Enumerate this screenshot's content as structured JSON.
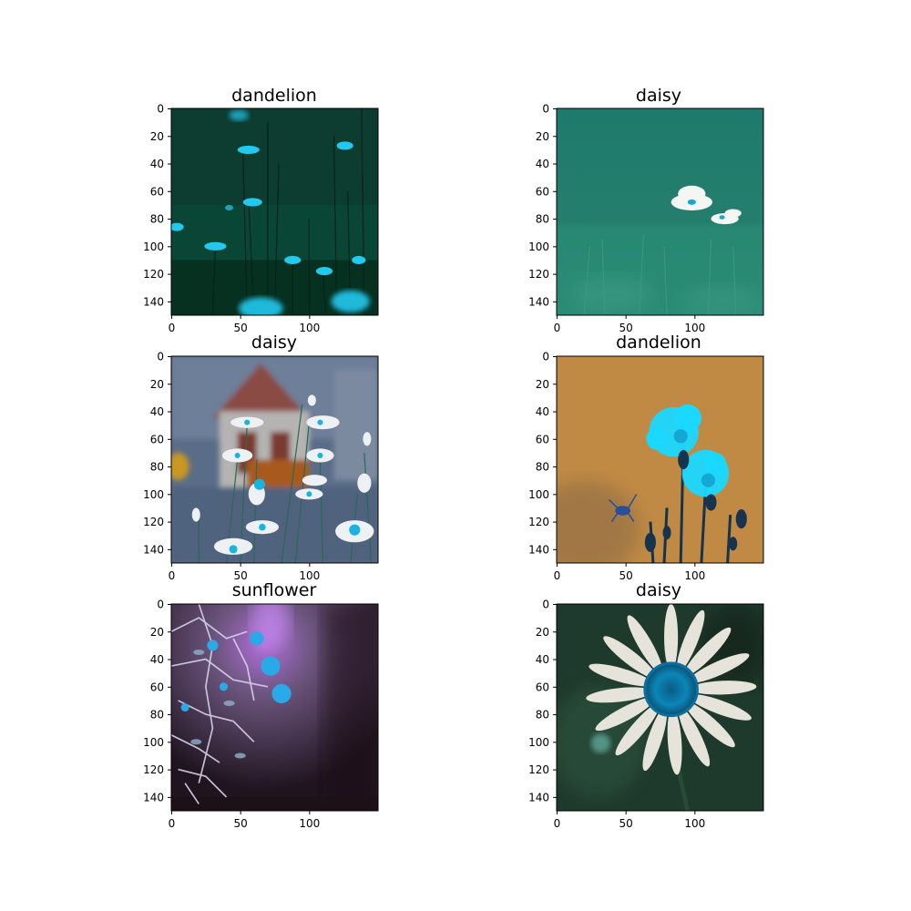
{
  "figure": {
    "layout": "3x2 grid of image subplots",
    "background": "#ffffff"
  },
  "chart_data": [
    {
      "type": "image",
      "title": "dandelion",
      "xlabel": "",
      "ylabel": "",
      "xlim": [
        0,
        150
      ],
      "ylim": [
        150,
        0
      ],
      "xticks": [
        0,
        50,
        100
      ],
      "yticks": [
        0,
        20,
        40,
        60,
        80,
        100,
        120,
        140
      ],
      "dominant_colors": [
        "#063828",
        "#0b4a3a",
        "#1ec6e8"
      ],
      "content": "dark green grass with small cyan flowers on thin stems"
    },
    {
      "type": "image",
      "title": "daisy",
      "xlabel": "",
      "ylabel": "",
      "xlim": [
        0,
        150
      ],
      "ylim": [
        150,
        0
      ],
      "xticks": [
        0,
        50,
        100
      ],
      "yticks": [
        0,
        20,
        40,
        60,
        80,
        100,
        120,
        140
      ],
      "dominant_colors": [
        "#1f7c6c",
        "#2e8c78",
        "#f2f4f0"
      ],
      "content": "teal blurred background with two small white daisies"
    },
    {
      "type": "image",
      "title": "daisy",
      "xlabel": "",
      "ylabel": "",
      "xlim": [
        0,
        150
      ],
      "ylim": [
        150,
        0
      ],
      "xticks": [
        0,
        50,
        100
      ],
      "yticks": [
        0,
        20,
        40,
        60,
        80,
        100,
        120,
        140
      ],
      "dominant_colors": [
        "#5c6f8c",
        "#8a4a42",
        "#e9eef2"
      ],
      "content": "blue-gray blurred house with white daisies in foreground"
    },
    {
      "type": "image",
      "title": "dandelion",
      "xlabel": "",
      "ylabel": "",
      "xlim": [
        0,
        150
      ],
      "ylim": [
        150,
        0
      ],
      "xticks": [
        0,
        50,
        100
      ],
      "yticks": [
        0,
        20,
        40,
        60,
        80,
        100,
        120,
        140
      ],
      "dominant_colors": [
        "#c08a45",
        "#19d6ff",
        "#14304a"
      ],
      "content": "orange-brown background with bright cyan flowers and dark stems"
    },
    {
      "type": "image",
      "title": "sunflower",
      "xlabel": "",
      "ylabel": "",
      "xlim": [
        0,
        150
      ],
      "ylim": [
        150,
        0
      ],
      "xticks": [
        0,
        50,
        100
      ],
      "yticks": [
        0,
        20,
        40,
        60,
        80,
        100,
        120,
        140
      ],
      "dominant_colors": [
        "#5a4868",
        "#2a1c2c",
        "#2aa9e8"
      ],
      "content": "purple-dark background with branching pale twigs and cyan blossoms"
    },
    {
      "type": "image",
      "title": "daisy",
      "xlabel": "",
      "ylabel": "",
      "xlim": [
        0,
        150
      ],
      "ylim": [
        150,
        0
      ],
      "xticks": [
        0,
        50,
        100
      ],
      "yticks": [
        0,
        20,
        40,
        60,
        80,
        100,
        120,
        140
      ],
      "dominant_colors": [
        "#1f3a2c",
        "#e8e6df",
        "#0b7fb0"
      ],
      "content": "close-up white daisy with blue center on dark green background"
    }
  ]
}
